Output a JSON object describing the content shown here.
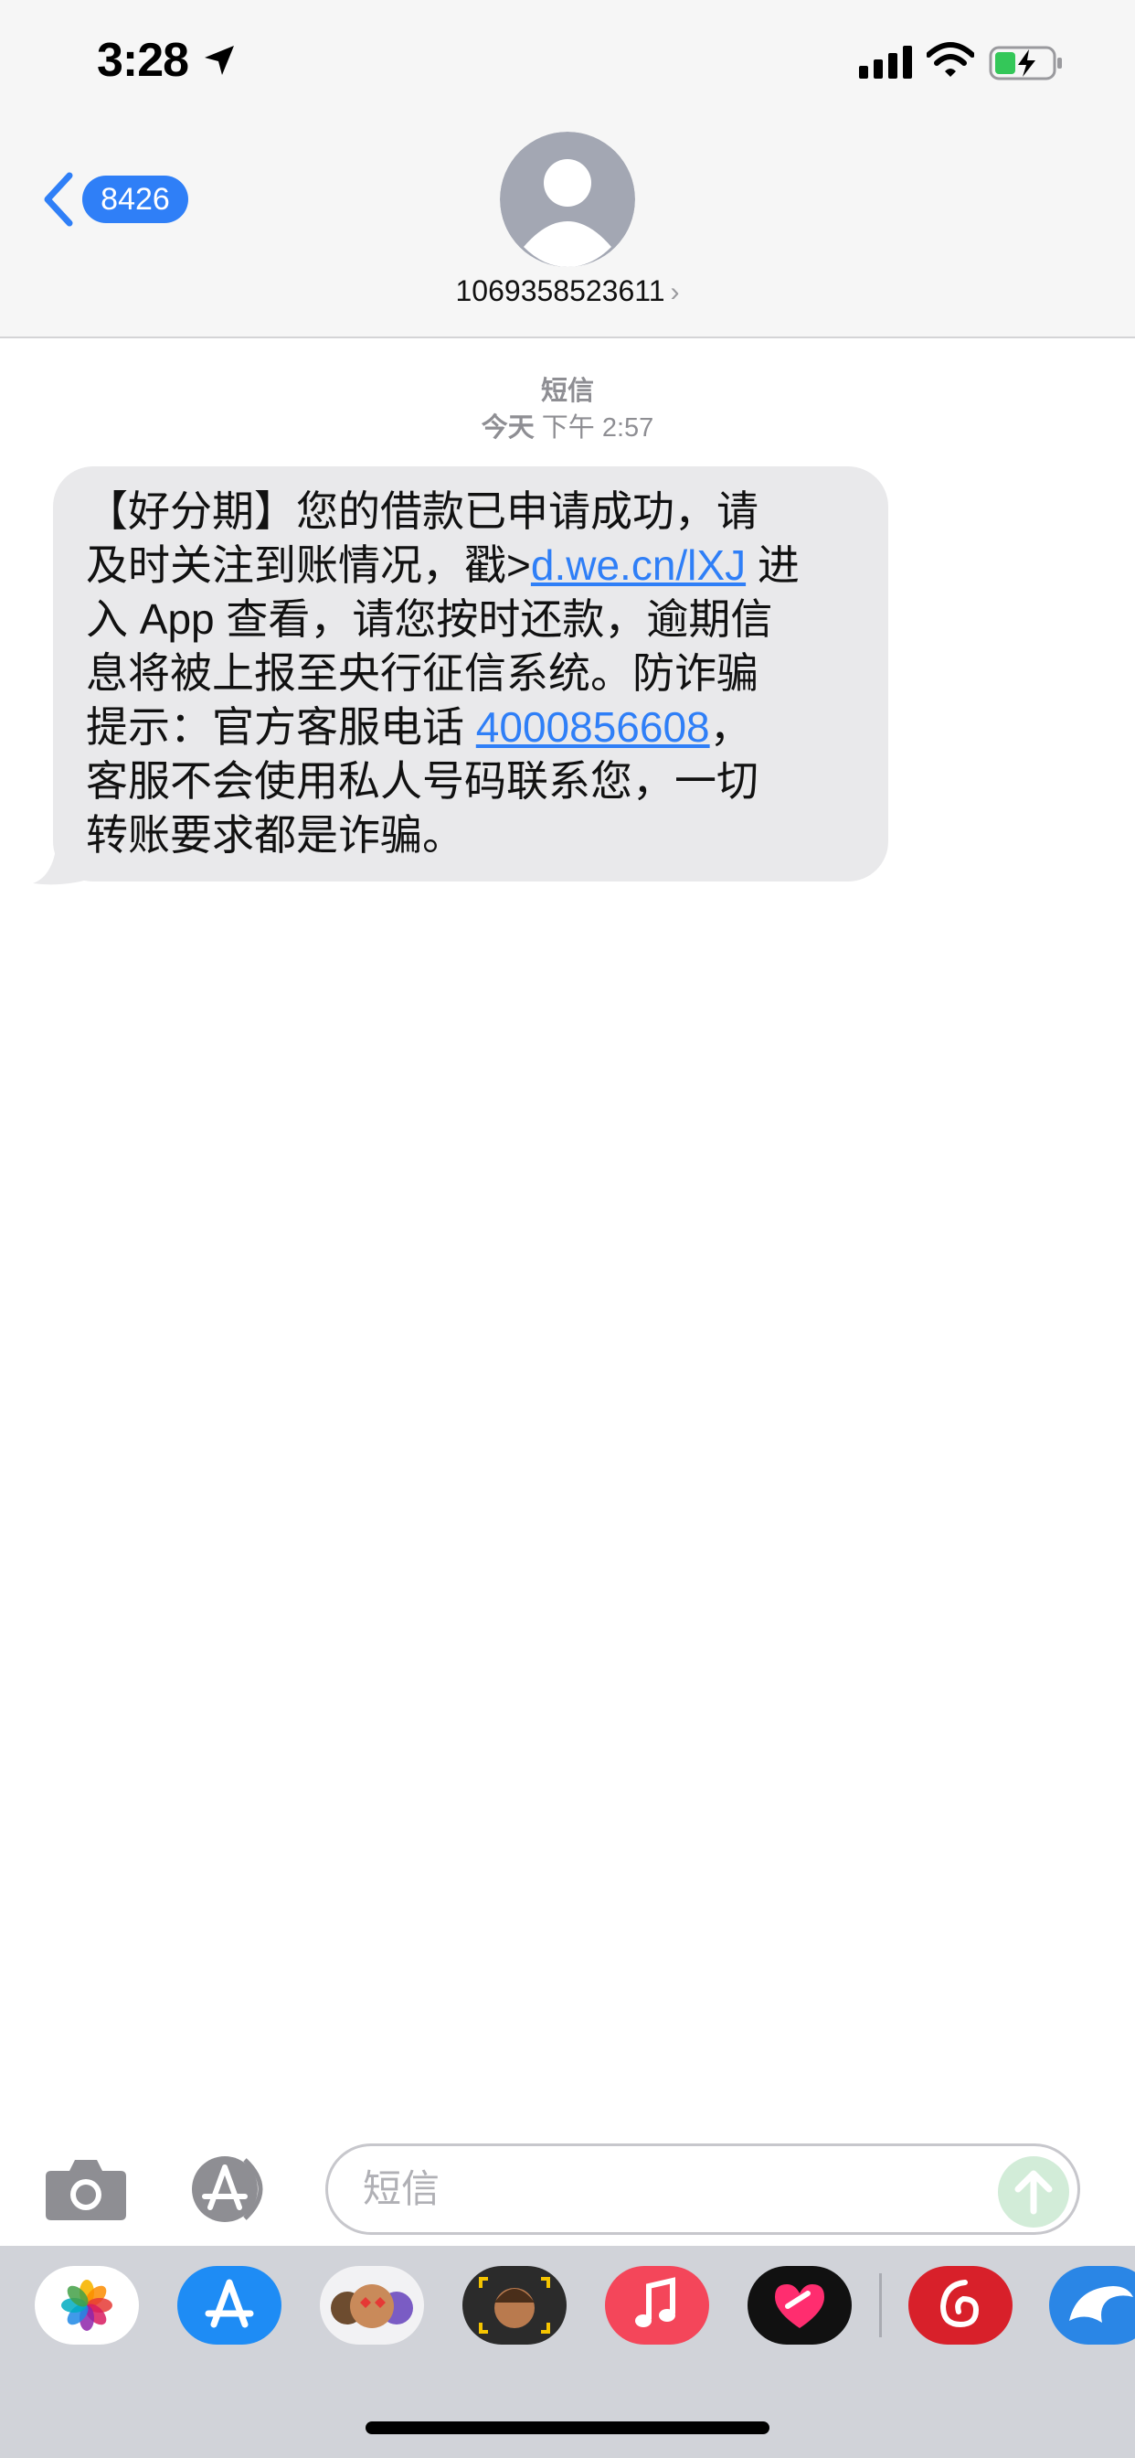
{
  "status_bar": {
    "time": "3:28"
  },
  "nav": {
    "back_count": "8426",
    "contact_number": "1069358523611",
    "contact_chevron": "›"
  },
  "thread": {
    "service_label": "短信",
    "date_label": "今天",
    "time_label": "下午 2:57"
  },
  "message": {
    "part1": "【好分期】您的借款已申请成功，请\n及时关注到账情况，戳>",
    "link_text": "d.we.cn/lXJ",
    "part2": " 进\n入 App 查看，请您按时还款，逾期信\n息将被上报至央行征信系统。防诈骗\n提示：官方客服电话 ",
    "phone_text": "4000856608",
    "part3": "，\n客服不会使用私人号码联系您，一切\n转账要求都是诈骗。"
  },
  "compose": {
    "placeholder": "短信"
  },
  "app_tray": {
    "apps": [
      "photos-icon",
      "app-store-icon",
      "memoji-stickers-icon",
      "animoji-icon",
      "music-icon",
      "heart-app-icon",
      "netease-music-icon",
      "dolphin-app-icon"
    ]
  },
  "colors": {
    "accent": "#2f7ff7",
    "bubble": "#e9e9eb",
    "header": "#f6f6f6",
    "tray": "#d1d3d9"
  }
}
